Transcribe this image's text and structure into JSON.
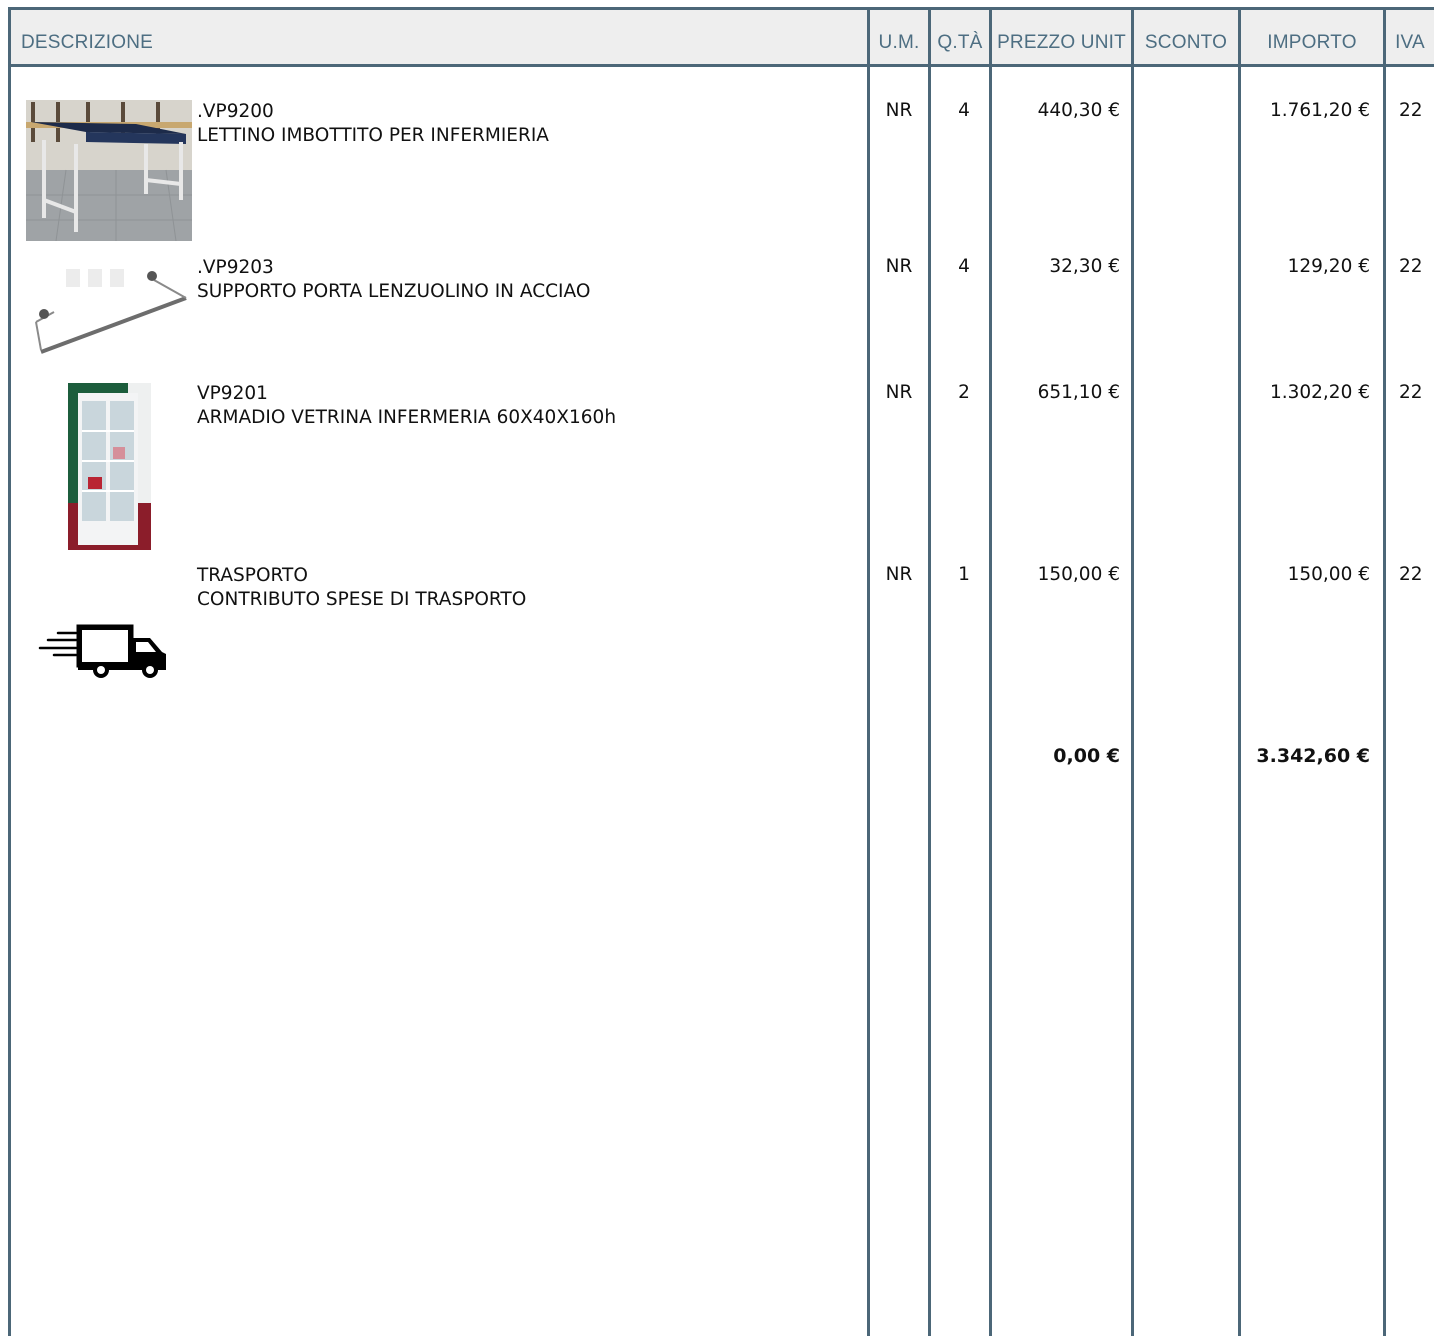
{
  "columns": {
    "descrizione": "DESCRIZIONE",
    "um": "U.M.",
    "qta": "Q.TÀ",
    "prezzo_unit": "PREZZO UNIT",
    "sconto": "SCONTO",
    "importo": "IMPORTO",
    "iva": "IVA"
  },
  "rows": [
    {
      "code": ".VP9200",
      "description": "LETTINO IMBOTTITO PER INFERMIERIA",
      "um": "NR",
      "qta": "4",
      "prezzo_unit": "440,30 €",
      "sconto": "",
      "importo": "1.761,20 €",
      "iva": "22",
      "image": "medical-bed-image"
    },
    {
      "code": ".VP9203",
      "description": "SUPPORTO PORTA LENZUOLINO IN ACCIAO",
      "um": "NR",
      "qta": "4",
      "prezzo_unit": "32,30 €",
      "sconto": "",
      "importo": "129,20 €",
      "iva": "22",
      "image": "sheet-holder-image"
    },
    {
      "code": "VP9201",
      "description": "ARMADIO VETRINA INFERMERIA 60X40X160h",
      "um": "NR",
      "qta": "2",
      "prezzo_unit": "651,10 €",
      "sconto": "",
      "importo": "1.302,20 €",
      "iva": "22",
      "image": "glass-cabinet-image"
    },
    {
      "code": "TRASPORTO",
      "description": "CONTRIBUTO SPESE DI TRASPORTO",
      "um": "NR",
      "qta": "1",
      "prezzo_unit": "150,00 €",
      "sconto": "",
      "importo": "150,00 €",
      "iva": "22",
      "image": "delivery-truck-icon"
    }
  ],
  "totals": {
    "prezzo_unit": "0,00 €",
    "importo": "3.342,60 €"
  },
  "colors": {
    "border": "#4c6778",
    "header_text": "#4d6e82",
    "header_bg": "#eeeeee"
  }
}
